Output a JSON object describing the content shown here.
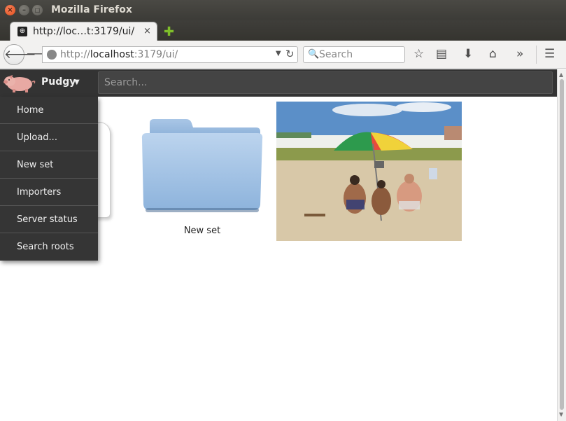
{
  "window": {
    "title": "Mozilla Firefox"
  },
  "tab": {
    "title": "http://loc…t:3179/ui/",
    "close": "×"
  },
  "newtab": "✚",
  "url": {
    "scheme": "http://",
    "host": "localhost",
    "rest": ":3179/ui/"
  },
  "browser_search": {
    "placeholder": "Search"
  },
  "app": {
    "brand": "Pudgy",
    "brand_caret": "▼",
    "search_placeholder": "Search...",
    "menu": [
      {
        "label": "Home"
      },
      {
        "label": "Upload..."
      },
      {
        "label": "New set"
      },
      {
        "label": "Importers"
      },
      {
        "label": "Server status"
      },
      {
        "label": "Search roots"
      }
    ],
    "tiles": [
      {
        "label": "New set"
      }
    ]
  },
  "colors": {
    "app_bar": "#333333",
    "menu_bg": "#353535",
    "folder_blue": "#8fb4dc",
    "close_button": "#e2501c"
  }
}
